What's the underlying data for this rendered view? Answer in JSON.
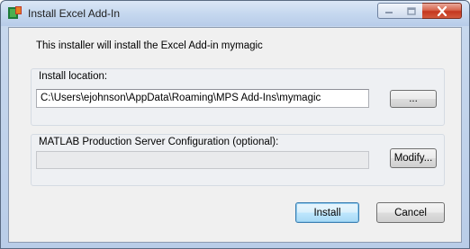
{
  "window": {
    "title": "Install Excel Add-In",
    "controls": {
      "minimize": "minimize",
      "maximize": "maximize",
      "close": "close"
    }
  },
  "main": {
    "intro_text": "This installer will install the Excel Add-in mymagic",
    "install_location": {
      "label": "Install location:",
      "value": "C:\\Users\\ejohnson\\AppData\\Roaming\\MPS Add-Ins\\mymagic",
      "browse_label": "..."
    },
    "mps_config": {
      "label": "MATLAB Production Server Configuration (optional):",
      "value": "",
      "modify_label": "Modify..."
    }
  },
  "footer": {
    "install_label": "Install",
    "cancel_label": "Cancel"
  },
  "colors": {
    "accent": "#3c7fb1",
    "close_button": "#c5371f"
  }
}
